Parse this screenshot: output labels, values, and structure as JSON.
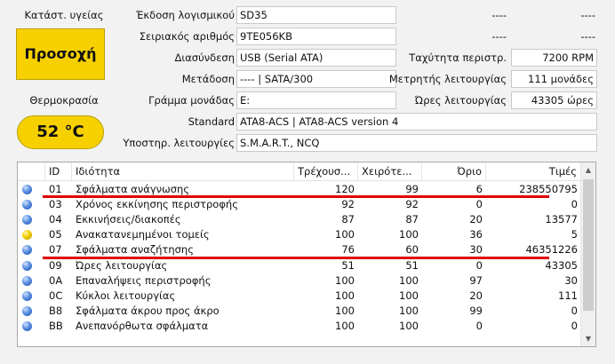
{
  "health": {
    "label": "Κατάστ. υγείας",
    "status": "Προσοχή",
    "color": "#f7d000"
  },
  "temperature": {
    "label": "Θερμοκρασία",
    "value": "52 °C"
  },
  "info": {
    "firmware_label": "Έκδοση λογισμικού",
    "firmware": "SD35",
    "serial_label": "Σειριακός αριθμός",
    "serial": "9TE056KB",
    "interface_label": "Διασύνδεση",
    "interface": "USB (Serial ATA)",
    "transfer_label": "Μετάδοση",
    "transfer": "---- | SATA/300",
    "drive_letter_label": "Γράμμα μονάδας",
    "drive_letter": "E:",
    "standard_label": "Standard",
    "standard": "ATA8-ACS | ATA8-ACS version 4",
    "features_label": "Υποστηρ. λειτουργίες",
    "features": "S.M.A.R.T., NCQ",
    "right_top1_a": "----",
    "right_top1_b": "----",
    "right_top2_a": "----",
    "right_top2_b": "----",
    "rpm_label": "Ταχύτητα περιστρ.",
    "rpm": "7200 RPM",
    "power_count_label": "Μετρητής λειτουργίας",
    "power_count": "111 μονάδες",
    "power_hours_label": "Ώρες λειτουργίας",
    "power_hours": "43305 ώρες"
  },
  "table": {
    "headers": {
      "id": "ID",
      "attr": "Ιδιότητα",
      "current": "Τρέχουσ...",
      "worst": "Χειρότε...",
      "threshold": "Όριο",
      "raw": "Τιμές"
    },
    "rows": [
      {
        "status": "blue",
        "id": "01",
        "name": "Σφάλματα ανάγνωσης",
        "current": "120",
        "worst": "99",
        "threshold": "6",
        "raw": "238550795"
      },
      {
        "status": "blue",
        "id": "03",
        "name": "Χρόνος εκκίνησης περιστροφής",
        "current": "92",
        "worst": "92",
        "threshold": "0",
        "raw": "0"
      },
      {
        "status": "blue",
        "id": "04",
        "name": "Εκκινήσεις/διακοπές",
        "current": "87",
        "worst": "87",
        "threshold": "20",
        "raw": "13577"
      },
      {
        "status": "yellow",
        "id": "05",
        "name": "Ανακατανεμημένοι τομείς",
        "current": "100",
        "worst": "100",
        "threshold": "36",
        "raw": "5"
      },
      {
        "status": "blue",
        "id": "07",
        "name": "Σφάλματα αναζήτησης",
        "current": "76",
        "worst": "60",
        "threshold": "30",
        "raw": "46351226"
      },
      {
        "status": "blue",
        "id": "09",
        "name": "Ώρες λειτουργίας",
        "current": "51",
        "worst": "51",
        "threshold": "0",
        "raw": "43305"
      },
      {
        "status": "blue",
        "id": "0A",
        "name": "Επαναλήψεις περιστροφής",
        "current": "100",
        "worst": "100",
        "threshold": "97",
        "raw": "30"
      },
      {
        "status": "blue",
        "id": "0C",
        "name": "Κύκλοι λειτουργίας",
        "current": "100",
        "worst": "100",
        "threshold": "20",
        "raw": "111"
      },
      {
        "status": "blue",
        "id": "B8",
        "name": "Σφάλματα άκρου προς άκρο",
        "current": "100",
        "worst": "100",
        "threshold": "99",
        "raw": "0"
      },
      {
        "status": "blue",
        "id": "BB",
        "name": "Ανεπανόρθωτα σφάλματα",
        "current": "100",
        "worst": "100",
        "threshold": "0",
        "raw": "0"
      }
    ]
  }
}
